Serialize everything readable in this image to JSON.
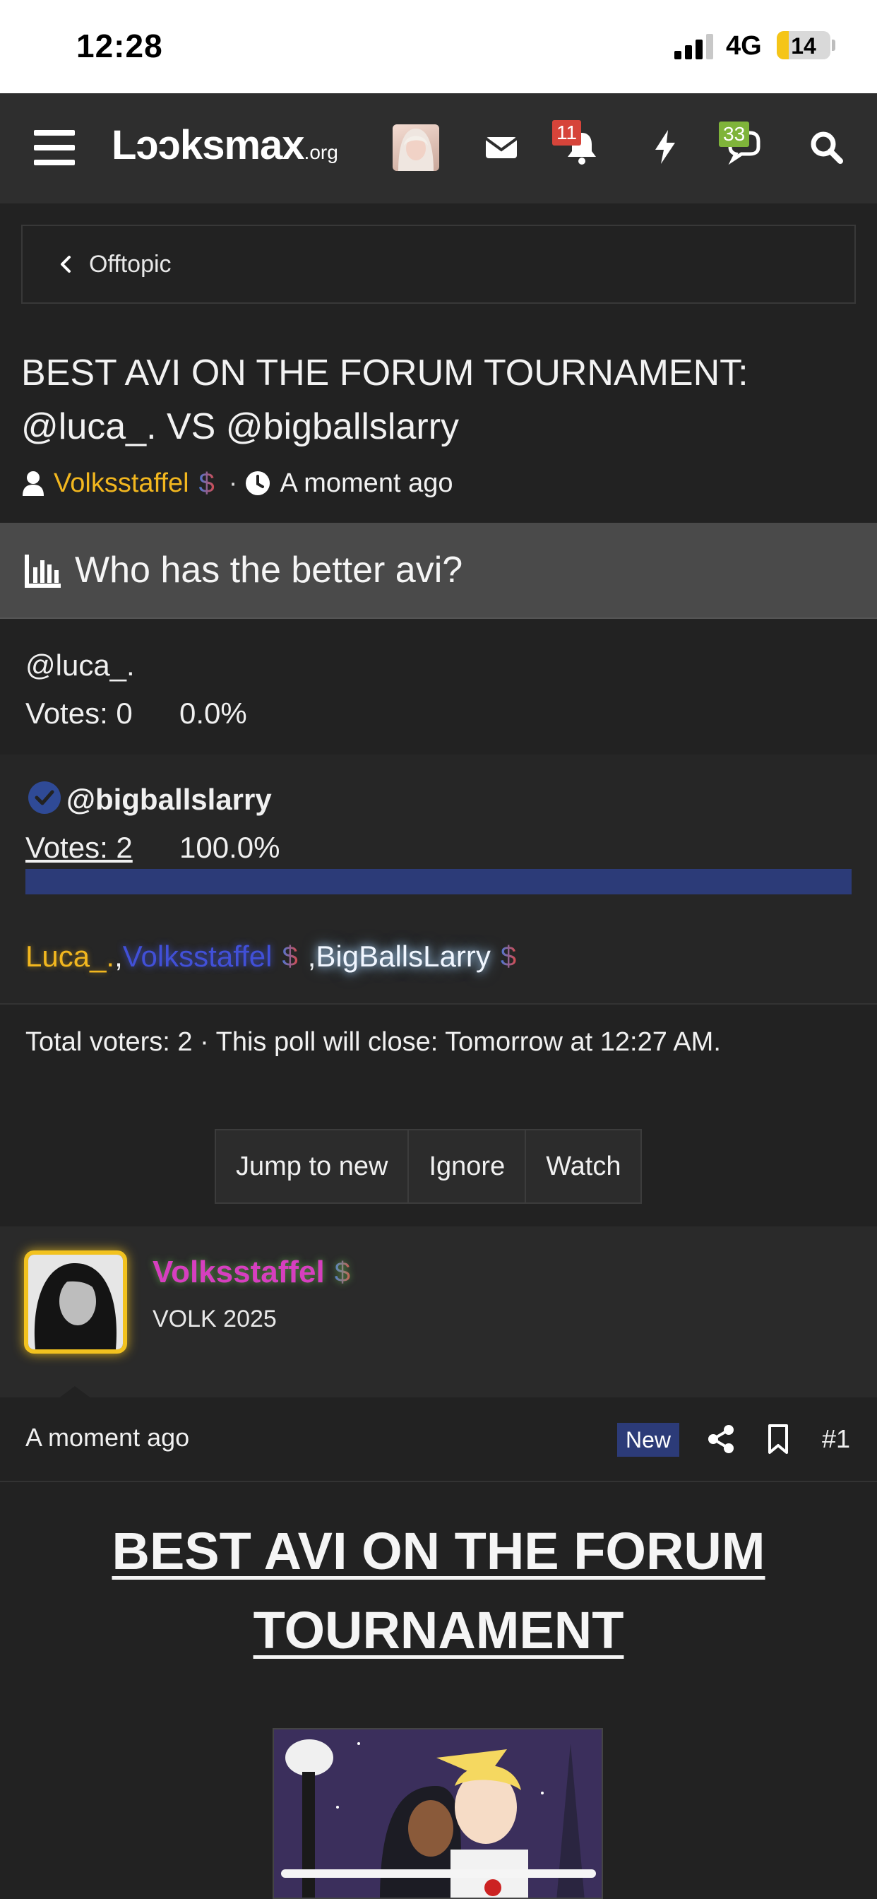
{
  "status_bar": {
    "time": "12:28",
    "network": "4G",
    "battery": "14",
    "battery_level": 0.14
  },
  "nav": {
    "logo_main": "Lɔɔksmax",
    "logo_suffix": ".org",
    "alerts_badge": "11",
    "conversations_badge": "33",
    "icons": [
      "menu-icon",
      "envelope-icon",
      "bell-icon",
      "bolt-icon",
      "chat-icon",
      "search-icon"
    ]
  },
  "breadcrumb": {
    "label": "Offtopic"
  },
  "thread": {
    "title": "BEST AVI ON THE FORUM TOURNAMENT: @luca_. VS @bigballslarry",
    "author": "Volksstaffel",
    "dollar_glyph": "$",
    "separator": "·",
    "time": "A moment ago"
  },
  "poll": {
    "question": "Who has the better avi?",
    "options": [
      {
        "label": "@luca_.",
        "votes": "Votes: 0",
        "percent": "0.0%",
        "fraction": 0.0
      },
      {
        "label": "@bigballslarry",
        "votes": "Votes: 2",
        "percent": "100.0%",
        "fraction": 1.0
      }
    ],
    "voters": {
      "v1": "Luca_.",
      "sep1": ", ",
      "v2": "Volksstaffel",
      "sep2": ", ",
      "v3": "BigBallsLarry"
    },
    "footer": "Total voters: 2 · This poll will close: Tomorrow at 12:27 AM."
  },
  "actions": {
    "jump": "Jump to new",
    "ignore": "Ignore",
    "watch": "Watch"
  },
  "post": {
    "username": "Volksstaffel",
    "user_title": "VOLK 2025",
    "time": "A moment ago",
    "new_badge": "New",
    "number": "#1",
    "heading": "BEST AVI ON THE FORUM TOURNAMENT"
  },
  "colors": {
    "accent_blue": "#2c3b78",
    "gold": "#f2b71f",
    "username_pink": "#d63fbf",
    "badge_red": "#d6443a",
    "badge_green": "#7fb43a"
  }
}
